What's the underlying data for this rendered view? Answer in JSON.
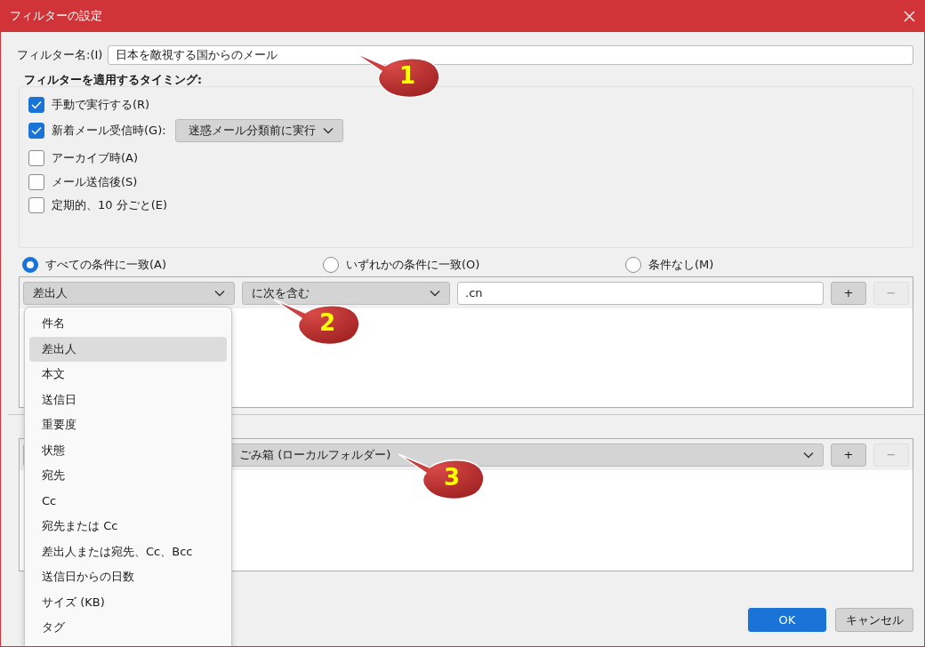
{
  "window": {
    "title": "フィルターの設定"
  },
  "filter_name": {
    "label": "フィルター名:(I)",
    "value": "日本を敵視する国からのメール"
  },
  "timing": {
    "label": "フィルターを適用するタイミング:",
    "options": [
      {
        "label": "手動で実行する(R)",
        "checked": true
      },
      {
        "label": "新着メール受信時(G):",
        "checked": true,
        "select": "迷惑メール分類前に実行"
      },
      {
        "label": "アーカイブ時(A)",
        "checked": false
      },
      {
        "label": "メール送信後(S)",
        "checked": false
      },
      {
        "label": "定期的、10 分ごと(E)",
        "checked": false
      }
    ]
  },
  "match": [
    {
      "label": "すべての条件に一致(A)",
      "selected": true
    },
    {
      "label": "いずれかの条件に一致(O)",
      "selected": false
    },
    {
      "label": "条件なし(M)",
      "selected": false
    }
  ],
  "condition": {
    "field": "差出人",
    "operator": "に次を含む",
    "value": ".cn",
    "buttons": [
      {
        "label": "+",
        "disabled": false
      },
      {
        "label": "−",
        "disabled": true
      }
    ]
  },
  "action": {
    "target": "ごみ箱 (ローカルフォルダー)",
    "buttons": [
      {
        "label": "+",
        "disabled": false
      },
      {
        "label": "−",
        "disabled": true
      }
    ]
  },
  "field_menu": [
    {
      "label": "件名",
      "selected": false
    },
    {
      "label": "差出人",
      "selected": true
    },
    {
      "label": "本文",
      "selected": false
    },
    {
      "label": "送信日",
      "selected": false
    },
    {
      "label": "重要度",
      "selected": false
    },
    {
      "label": "状態",
      "selected": false
    },
    {
      "label": "宛先",
      "selected": false
    },
    {
      "label": "Cc",
      "selected": false
    },
    {
      "label": "宛先または Cc",
      "selected": false
    },
    {
      "label": "差出人または宛先、Cc、Bcc",
      "selected": false
    },
    {
      "label": "送信日からの日数",
      "selected": false
    },
    {
      "label": "サイズ (KB)",
      "selected": false
    },
    {
      "label": "タグ",
      "selected": false
    }
  ],
  "callouts": [
    "1",
    "2",
    "3"
  ],
  "buttons": [
    {
      "label": "OK",
      "kind": "primary"
    },
    {
      "label": "キャンセル",
      "kind": "normal"
    }
  ]
}
